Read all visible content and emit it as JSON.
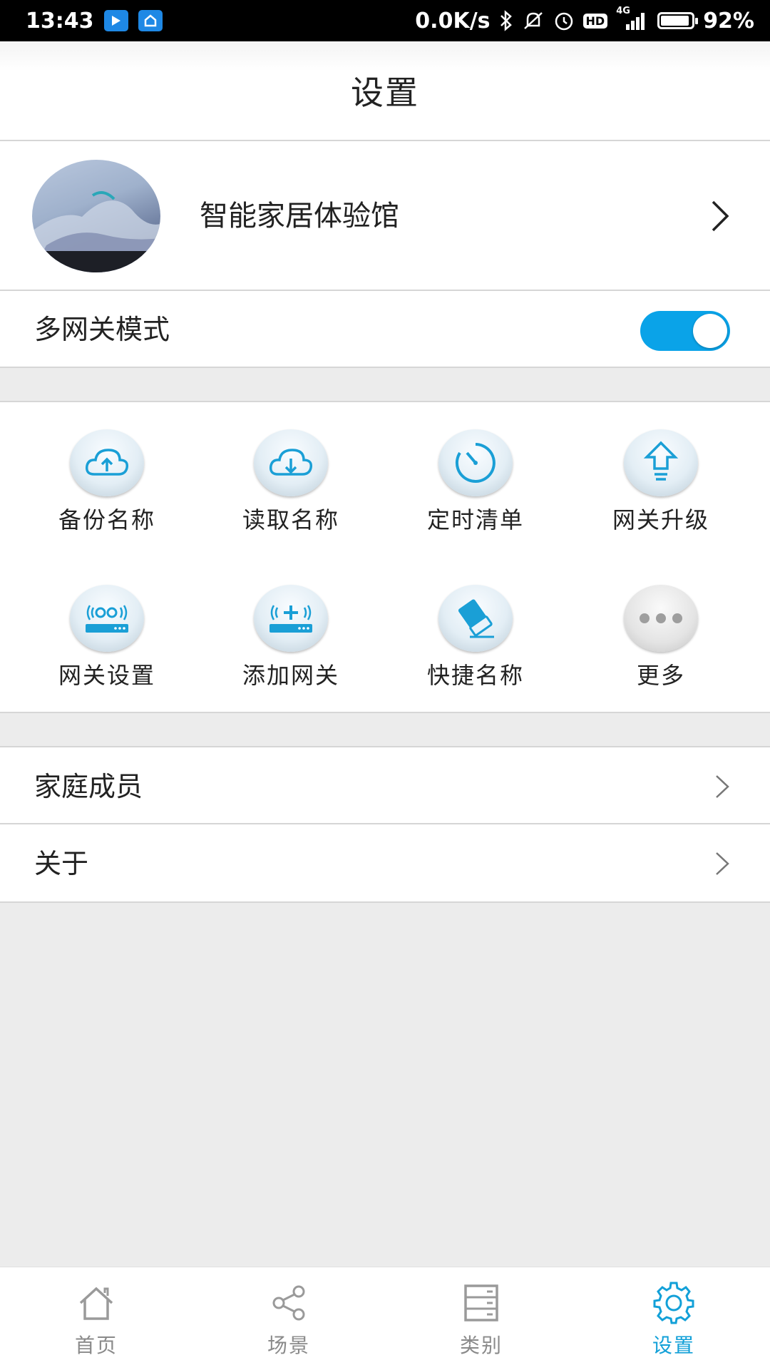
{
  "status_bar": {
    "time": "13:43",
    "network_speed": "0.0K/s",
    "network_type": "4G",
    "hd_label": "HD",
    "battery": "92%",
    "battery_level": 0.92
  },
  "header": {
    "title": "设置"
  },
  "profile": {
    "name": "智能家居体验馆"
  },
  "multi_gateway": {
    "label": "多网关模式",
    "enabled": true
  },
  "grid": {
    "items": [
      {
        "label": "备份名称",
        "icon": "cloud-upload-icon"
      },
      {
        "label": "读取名称",
        "icon": "cloud-download-icon"
      },
      {
        "label": "定时清单",
        "icon": "timer-icon"
      },
      {
        "label": "网关升级",
        "icon": "upgrade-arrow-icon"
      },
      {
        "label": "网关设置",
        "icon": "gateway-settings-icon"
      },
      {
        "label": "添加网关",
        "icon": "add-gateway-icon"
      },
      {
        "label": "快捷名称",
        "icon": "eraser-icon"
      },
      {
        "label": "更多",
        "icon": "more-dots-icon"
      }
    ]
  },
  "list": {
    "items": [
      {
        "label": "家庭成员"
      },
      {
        "label": "关于"
      }
    ]
  },
  "tabs": {
    "items": [
      {
        "label": "首页",
        "icon": "home-icon"
      },
      {
        "label": "场景",
        "icon": "share-nodes-icon"
      },
      {
        "label": "类别",
        "icon": "category-list-icon"
      },
      {
        "label": "设置",
        "icon": "gear-icon",
        "active": true
      }
    ]
  },
  "colors": {
    "accent": "#0aa3e8",
    "active_tab": "#12a0d8",
    "icon_blue": "#1a9fd6",
    "background": "#ececec"
  }
}
